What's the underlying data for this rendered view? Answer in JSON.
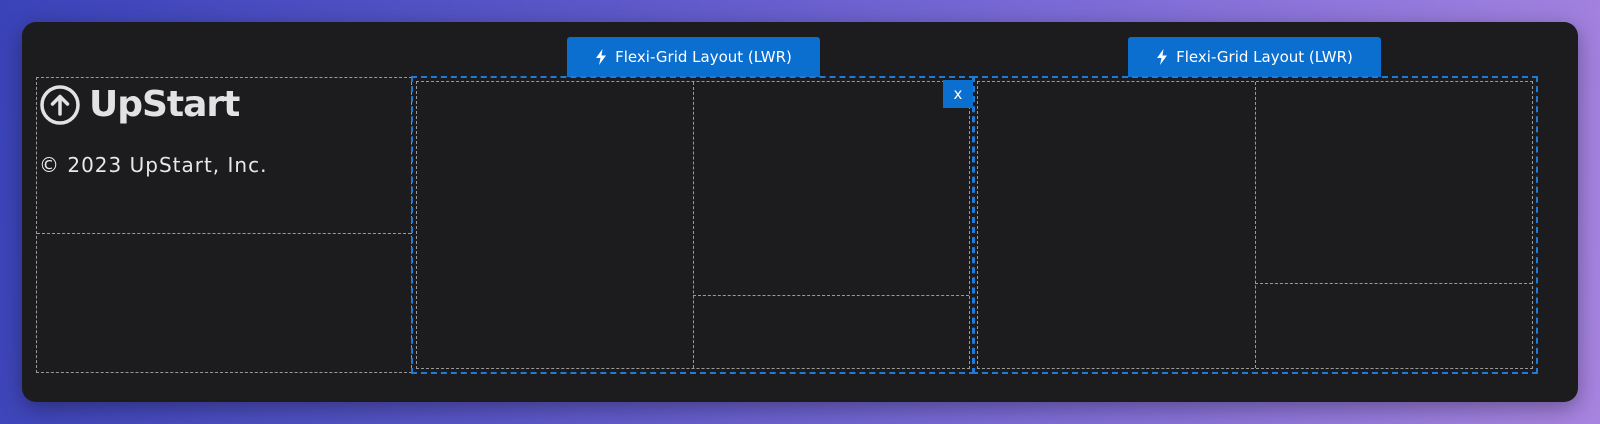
{
  "footer": {
    "brand_name": "UpStart",
    "logo_icon": "arrow-up-circle-icon",
    "copyright": "© 2023 UpStart, Inc."
  },
  "layouts": [
    {
      "label": "Flexi-Grid Layout (LWR)",
      "icon": "lightning-bolt-icon"
    },
    {
      "label": "Flexi-Grid Layout (LWR)",
      "icon": "lightning-bolt-icon"
    }
  ],
  "close_button": {
    "label": "x"
  },
  "colors": {
    "panel_bg": "#1c1c1e",
    "accent": "#0b6fd0",
    "dashed_border": "#9a9a9a"
  }
}
